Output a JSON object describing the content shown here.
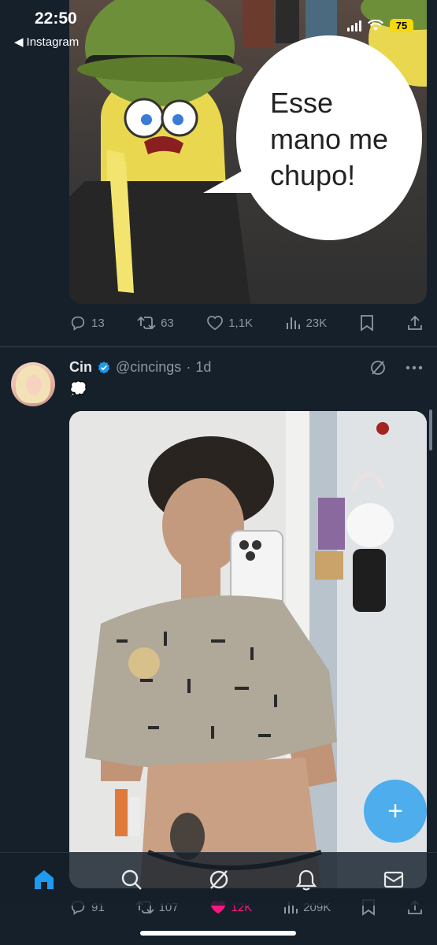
{
  "status_bar": {
    "time": "22:50",
    "back_app": "Instagram",
    "battery": "75",
    "icons": [
      "signal-icon",
      "wifi-icon",
      "battery-icon"
    ]
  },
  "posts": [
    {
      "image_text": "Esse\nmano me\nchupo!",
      "stats": {
        "replies": "13",
        "reposts": "63",
        "likes": "1,1K",
        "views": "23K"
      }
    },
    {
      "display_name": "Cin",
      "verified": true,
      "handle": "@cincings",
      "separator": "·",
      "time": "1d",
      "text": "💭",
      "stats": {
        "replies": "91",
        "reposts": "107",
        "likes": "12K",
        "views": "209K",
        "liked": true
      }
    }
  ],
  "fab": {
    "label": "+"
  },
  "bottom_nav": [
    "home-icon",
    "search-icon",
    "grok-icon",
    "notifications-icon",
    "messages-icon"
  ],
  "colors": {
    "background": "#15202b",
    "accent": "#1d9bf0",
    "like": "#f91880",
    "muted": "#8b98a5",
    "battery": "#f5d90a"
  }
}
